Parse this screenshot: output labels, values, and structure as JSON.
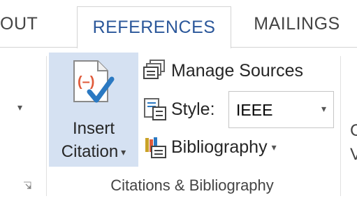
{
  "tabs": [
    {
      "label": "OUT",
      "active": false
    },
    {
      "label": "REFERENCES",
      "active": true
    },
    {
      "label": "MAILINGS",
      "active": false
    }
  ],
  "ribbon": {
    "insert_citation": {
      "line1": "Insert",
      "line2": "Citation",
      "caret": "▾",
      "icon": "insert-citation-icon"
    },
    "manage_sources": {
      "label": "Manage Sources",
      "icon": "manage-sources-icon"
    },
    "style": {
      "label": "Style:",
      "value": "IEEE",
      "caret": "▾",
      "icon": "style-icon"
    },
    "bibliography": {
      "label": "Bibliography",
      "caret": "▾",
      "icon": "bibliography-icon"
    },
    "group_label": "Citations & Bibliography",
    "left_caret": "▾",
    "cut_right_1": "C",
    "cut_right_2": "V"
  },
  "colors": {
    "accent": "#2b579a",
    "selected_bg": "#d5e1f2",
    "icon_red": "#e05a3a",
    "icon_blue": "#2b79c2"
  }
}
